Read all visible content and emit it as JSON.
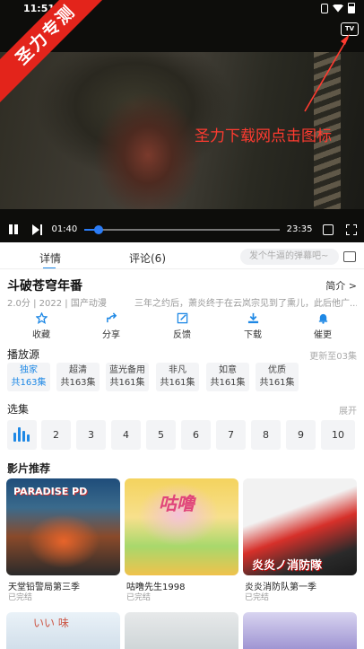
{
  "status_bar": {
    "time": "11:51"
  },
  "video": {
    "ribbon_text": "圣力专测",
    "tv_label": "TV",
    "hint_text": "圣力下载网点击图标",
    "current_time": "01:40",
    "total_time": "23:35",
    "progress": 0.072,
    "accent_color": "#1e88e5"
  },
  "tabs": {
    "detail": "详情",
    "comment": "评论(6)",
    "danmu_placeholder": "发个牛逼的弹幕吧~"
  },
  "show": {
    "title": "斗破苍穹年番",
    "intro_label": "简介 >",
    "score": "2.0分",
    "year": "2022",
    "category": "国产动漫",
    "description": "三年之约后，萧炎终于在云岚宗见到了熏儿，此后他广..."
  },
  "actions": [
    {
      "label": "收藏",
      "icon": "star-icon"
    },
    {
      "label": "分享",
      "icon": "share-icon"
    },
    {
      "label": "反馈",
      "icon": "edit-icon"
    },
    {
      "label": "下载",
      "icon": "download-icon"
    },
    {
      "label": "催更",
      "icon": "bell-icon"
    }
  ],
  "sources": {
    "title": "播放源",
    "update_note": "更新至03集",
    "items": [
      {
        "name": "独家",
        "count": "共163集",
        "active": true
      },
      {
        "name": "超清",
        "count": "共163集",
        "active": false
      },
      {
        "name": "蓝光备用",
        "count": "共161集",
        "active": false
      },
      {
        "name": "非凡",
        "count": "共161集",
        "active": false
      },
      {
        "name": "如意",
        "count": "共161集",
        "active": false
      },
      {
        "name": "优质",
        "count": "共161集",
        "active": false
      }
    ]
  },
  "episodes": {
    "title": "选集",
    "expand": "展开",
    "items": [
      "2",
      "3",
      "4",
      "5",
      "6",
      "7",
      "8",
      "9",
      "10"
    ]
  },
  "recommend": {
    "title": "影片推荐",
    "items": [
      {
        "name": "天堂铅警局第三季",
        "status": "已完结",
        "poster_text": "PARADISE PD"
      },
      {
        "name": "咕噜先生1998",
        "status": "已完结",
        "poster_text": "咕噜"
      },
      {
        "name": "炎炎消防队第一季",
        "status": "已完结",
        "poster_text": "炎炎ノ消防隊"
      }
    ],
    "next_row": [
      {
        "poster_text": "いい 味"
      },
      {
        "poster_text": ""
      },
      {
        "poster_text": ""
      }
    ]
  }
}
